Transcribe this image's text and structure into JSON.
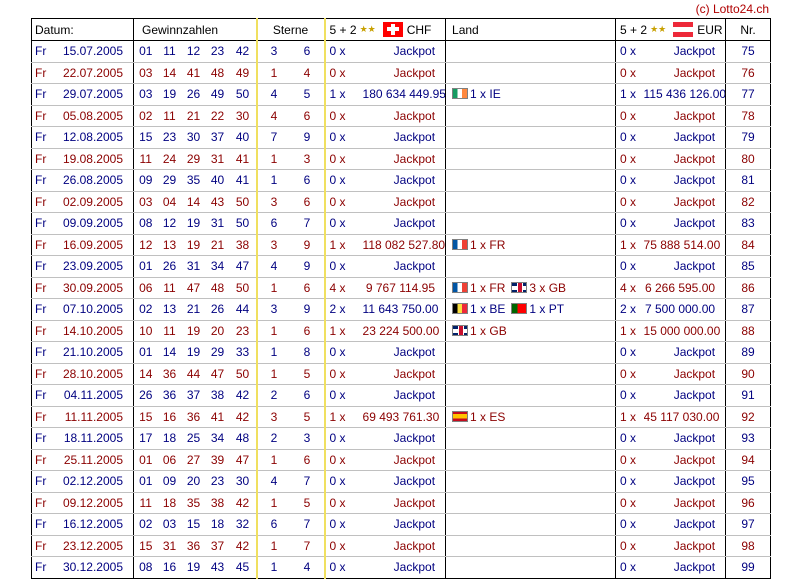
{
  "credit": "(c) Lotto24.ch",
  "headers": {
    "date": "Datum:",
    "numbers": "Gewinnzahlen",
    "stars": "Sterne",
    "ch_formula": "5 + 2",
    "ch_currency": "CHF",
    "land": "Land",
    "eu_formula": "5 + 2",
    "eu_currency": "EUR",
    "nr": "Nr."
  },
  "rows": [
    {
      "day": "Fr",
      "date": "15.07.2005",
      "n": [
        "01",
        "11",
        "12",
        "23",
        "42"
      ],
      "s": [
        "3",
        "6"
      ],
      "cc": "0 x",
      "ca": "Jackpot",
      "land": [],
      "ec": "0 x",
      "ea": "Jackpot",
      "nr": "75"
    },
    {
      "day": "Fr",
      "date": "22.07.2005",
      "n": [
        "03",
        "14",
        "41",
        "48",
        "49"
      ],
      "s": [
        "1",
        "4"
      ],
      "cc": "0 x",
      "ca": "Jackpot",
      "land": [],
      "ec": "0 x",
      "ea": "Jackpot",
      "nr": "76"
    },
    {
      "day": "Fr",
      "date": "29.07.2005",
      "n": [
        "03",
        "19",
        "26",
        "49",
        "50"
      ],
      "s": [
        "4",
        "5"
      ],
      "cc": "1 x",
      "ca": "180 634 449.95",
      "land": [
        {
          "flag": "ie",
          "text": "1 x IE"
        }
      ],
      "ec": "1 x",
      "ea": "115 436 126.00",
      "nr": "77"
    },
    {
      "day": "Fr",
      "date": "05.08.2005",
      "n": [
        "02",
        "11",
        "21",
        "22",
        "30"
      ],
      "s": [
        "4",
        "6"
      ],
      "cc": "0 x",
      "ca": "Jackpot",
      "land": [],
      "ec": "0 x",
      "ea": "Jackpot",
      "nr": "78"
    },
    {
      "day": "Fr",
      "date": "12.08.2005",
      "n": [
        "15",
        "23",
        "30",
        "37",
        "40"
      ],
      "s": [
        "7",
        "9"
      ],
      "cc": "0 x",
      "ca": "Jackpot",
      "land": [],
      "ec": "0 x",
      "ea": "Jackpot",
      "nr": "79"
    },
    {
      "day": "Fr",
      "date": "19.08.2005",
      "n": [
        "11",
        "24",
        "29",
        "31",
        "41"
      ],
      "s": [
        "1",
        "3"
      ],
      "cc": "0 x",
      "ca": "Jackpot",
      "land": [],
      "ec": "0 x",
      "ea": "Jackpot",
      "nr": "80"
    },
    {
      "day": "Fr",
      "date": "26.08.2005",
      "n": [
        "09",
        "29",
        "35",
        "40",
        "41"
      ],
      "s": [
        "1",
        "6"
      ],
      "cc": "0 x",
      "ca": "Jackpot",
      "land": [],
      "ec": "0 x",
      "ea": "Jackpot",
      "nr": "81"
    },
    {
      "day": "Fr",
      "date": "02.09.2005",
      "n": [
        "03",
        "04",
        "14",
        "43",
        "50"
      ],
      "s": [
        "3",
        "6"
      ],
      "cc": "0 x",
      "ca": "Jackpot",
      "land": [],
      "ec": "0 x",
      "ea": "Jackpot",
      "nr": "82"
    },
    {
      "day": "Fr",
      "date": "09.09.2005",
      "n": [
        "08",
        "12",
        "19",
        "31",
        "50"
      ],
      "s": [
        "6",
        "7"
      ],
      "cc": "0 x",
      "ca": "Jackpot",
      "land": [],
      "ec": "0 x",
      "ea": "Jackpot",
      "nr": "83"
    },
    {
      "day": "Fr",
      "date": "16.09.2005",
      "n": [
        "12",
        "13",
        "19",
        "21",
        "38"
      ],
      "s": [
        "3",
        "9"
      ],
      "cc": "1 x",
      "ca": "118 082 527.80",
      "land": [
        {
          "flag": "fr",
          "text": "1 x FR"
        }
      ],
      "ec": "1 x",
      "ea": "75 888 514.00",
      "nr": "84"
    },
    {
      "day": "Fr",
      "date": "23.09.2005",
      "n": [
        "01",
        "26",
        "31",
        "34",
        "47"
      ],
      "s": [
        "4",
        "9"
      ],
      "cc": "0 x",
      "ca": "Jackpot",
      "land": [],
      "ec": "0 x",
      "ea": "Jackpot",
      "nr": "85"
    },
    {
      "day": "Fr",
      "date": "30.09.2005",
      "n": [
        "06",
        "11",
        "47",
        "48",
        "50"
      ],
      "s": [
        "1",
        "6"
      ],
      "cc": "4 x",
      "ca": "9 767 114.95",
      "land": [
        {
          "flag": "fr",
          "text": "1 x FR"
        },
        {
          "flag": "gb",
          "text": "3 x GB"
        }
      ],
      "ec": "4 x",
      "ea": "6 266 595.00",
      "nr": "86"
    },
    {
      "day": "Fr",
      "date": "07.10.2005",
      "n": [
        "02",
        "13",
        "21",
        "26",
        "44"
      ],
      "s": [
        "3",
        "9"
      ],
      "cc": "2 x",
      "ca": "11 643 750.00",
      "land": [
        {
          "flag": "be",
          "text": "1 x BE"
        },
        {
          "flag": "pt",
          "text": "1 x PT"
        }
      ],
      "ec": "2 x",
      "ea": "7 500 000.00",
      "nr": "87"
    },
    {
      "day": "Fr",
      "date": "14.10.2005",
      "n": [
        "10",
        "11",
        "19",
        "20",
        "23"
      ],
      "s": [
        "1",
        "6"
      ],
      "cc": "1 x",
      "ca": "23 224 500.00",
      "land": [
        {
          "flag": "gb",
          "text": "1 x GB"
        }
      ],
      "ec": "1 x",
      "ea": "15 000 000.00",
      "nr": "88"
    },
    {
      "day": "Fr",
      "date": "21.10.2005",
      "n": [
        "01",
        "14",
        "19",
        "29",
        "33"
      ],
      "s": [
        "1",
        "8"
      ],
      "cc": "0 x",
      "ca": "Jackpot",
      "land": [],
      "ec": "0 x",
      "ea": "Jackpot",
      "nr": "89"
    },
    {
      "day": "Fr",
      "date": "28.10.2005",
      "n": [
        "14",
        "36",
        "44",
        "47",
        "50"
      ],
      "s": [
        "1",
        "5"
      ],
      "cc": "0 x",
      "ca": "Jackpot",
      "land": [],
      "ec": "0 x",
      "ea": "Jackpot",
      "nr": "90"
    },
    {
      "day": "Fr",
      "date": "04.11.2005",
      "n": [
        "26",
        "36",
        "37",
        "38",
        "42"
      ],
      "s": [
        "2",
        "6"
      ],
      "cc": "0 x",
      "ca": "Jackpot",
      "land": [],
      "ec": "0 x",
      "ea": "Jackpot",
      "nr": "91"
    },
    {
      "day": "Fr",
      "date": "11.11.2005",
      "n": [
        "15",
        "16",
        "36",
        "41",
        "42"
      ],
      "s": [
        "3",
        "5"
      ],
      "cc": "1 x",
      "ca": "69 493 761.30",
      "land": [
        {
          "flag": "es",
          "text": "1 x ES"
        }
      ],
      "ec": "1 x",
      "ea": "45 117 030.00",
      "nr": "92"
    },
    {
      "day": "Fr",
      "date": "18.11.2005",
      "n": [
        "17",
        "18",
        "25",
        "34",
        "48"
      ],
      "s": [
        "2",
        "3"
      ],
      "cc": "0 x",
      "ca": "Jackpot",
      "land": [],
      "ec": "0 x",
      "ea": "Jackpot",
      "nr": "93"
    },
    {
      "day": "Fr",
      "date": "25.11.2005",
      "n": [
        "01",
        "06",
        "27",
        "39",
        "47"
      ],
      "s": [
        "1",
        "6"
      ],
      "cc": "0 x",
      "ca": "Jackpot",
      "land": [],
      "ec": "0 x",
      "ea": "Jackpot",
      "nr": "94"
    },
    {
      "day": "Fr",
      "date": "02.12.2005",
      "n": [
        "01",
        "09",
        "20",
        "23",
        "30"
      ],
      "s": [
        "4",
        "7"
      ],
      "cc": "0 x",
      "ca": "Jackpot",
      "land": [],
      "ec": "0 x",
      "ea": "Jackpot",
      "nr": "95"
    },
    {
      "day": "Fr",
      "date": "09.12.2005",
      "n": [
        "11",
        "18",
        "35",
        "38",
        "42"
      ],
      "s": [
        "1",
        "5"
      ],
      "cc": "0 x",
      "ca": "Jackpot",
      "land": [],
      "ec": "0 x",
      "ea": "Jackpot",
      "nr": "96"
    },
    {
      "day": "Fr",
      "date": "16.12.2005",
      "n": [
        "02",
        "03",
        "15",
        "18",
        "32"
      ],
      "s": [
        "6",
        "7"
      ],
      "cc": "0 x",
      "ca": "Jackpot",
      "land": [],
      "ec": "0 x",
      "ea": "Jackpot",
      "nr": "97"
    },
    {
      "day": "Fr",
      "date": "23.12.2005",
      "n": [
        "15",
        "31",
        "36",
        "37",
        "42"
      ],
      "s": [
        "1",
        "7"
      ],
      "cc": "0 x",
      "ca": "Jackpot",
      "land": [],
      "ec": "0 x",
      "ea": "Jackpot",
      "nr": "98"
    },
    {
      "day": "Fr",
      "date": "30.12.2005",
      "n": [
        "08",
        "16",
        "19",
        "43",
        "45"
      ],
      "s": [
        "1",
        "4"
      ],
      "cc": "0 x",
      "ca": "Jackpot",
      "land": [],
      "ec": "0 x",
      "ea": "Jackpot",
      "nr": "99"
    }
  ]
}
